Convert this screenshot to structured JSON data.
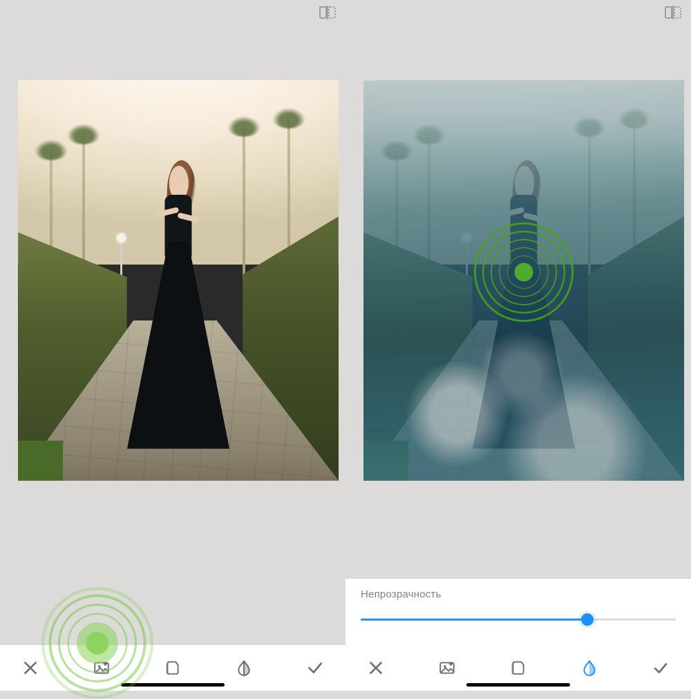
{
  "icons": {
    "compare": "compare-icon",
    "close": "close-icon",
    "add_image": "add-image-icon",
    "styles": "styles-icon",
    "opacity": "opacity-icon",
    "confirm": "check-icon"
  },
  "left_screen": {
    "toolbar": {
      "close": "✕",
      "add_image": "add-image",
      "styles": "styles",
      "opacity": "opacity",
      "confirm": "✓",
      "active": "add_image"
    },
    "touch_hint_target": "add-image-button"
  },
  "right_screen": {
    "slider": {
      "label": "Непрозрачность",
      "value_pct": 72
    },
    "toolbar": {
      "close": "✕",
      "add_image": "add-image",
      "styles": "styles",
      "opacity": "opacity",
      "confirm": "✓",
      "active": "opacity"
    },
    "touch_hint_target": "canvas-center"
  },
  "colors": {
    "accent": "#1f8fff",
    "hint": "#54b81f",
    "bg": "#dcdbda"
  }
}
